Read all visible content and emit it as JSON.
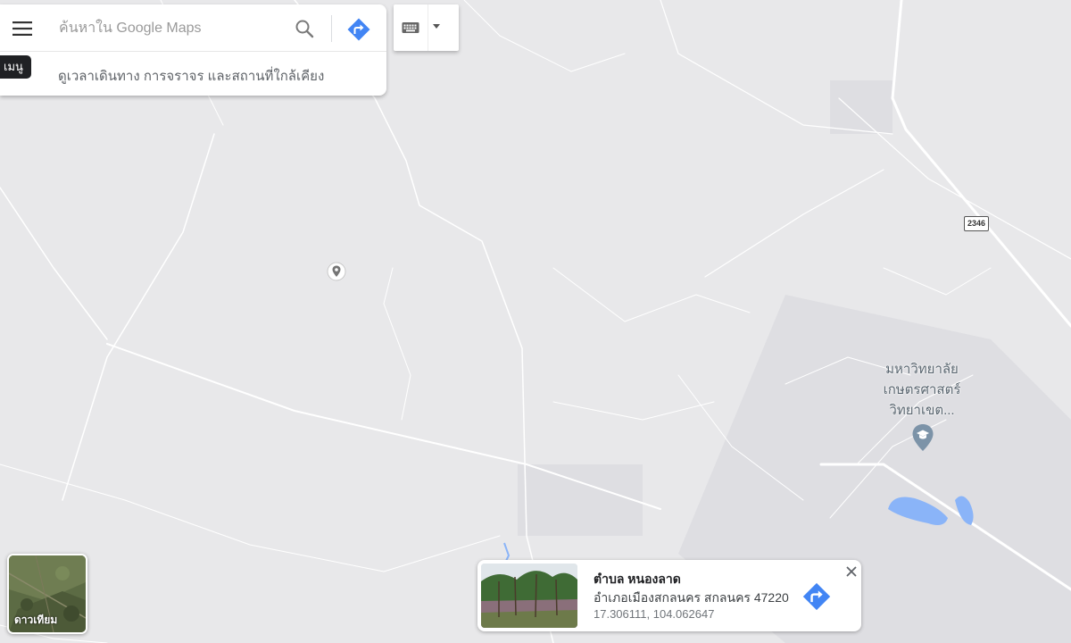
{
  "search": {
    "placeholder": "ค้นหาใน Google Maps",
    "hint": "ดูเวลาเดินทาง การจราจร และสถานที่ใกล้เคียง",
    "menu_tooltip": "เมนู"
  },
  "map": {
    "poi": {
      "name": "มหาวิทยาลัยเกษตรศาสตร์วิทยาเขต...",
      "icon": "graduation-cap-icon"
    },
    "road_shield": "2346"
  },
  "satellite": {
    "label": "ดาวเทียม"
  },
  "place_card": {
    "title": "ตำบล หนองลาด",
    "address": "อำเภอเมืองสกลนคร สกลนคร 47220",
    "coords": "17.306111, 104.062647"
  },
  "colors": {
    "map_background": "#e8e8ea",
    "road": "#ffffff",
    "water": "#8ab4f8",
    "accent_blue": "#4285f4",
    "poi_icon": "#7c93a8"
  }
}
